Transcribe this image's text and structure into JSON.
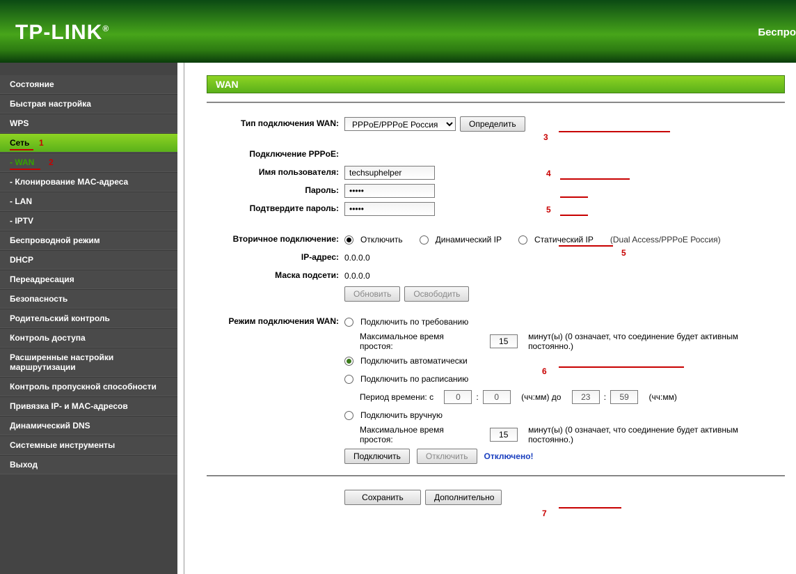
{
  "header": {
    "logo": "TP-LINK",
    "reg": "®",
    "right": "Беспро"
  },
  "sidebar": [
    {
      "label": "Состояние",
      "cls": ""
    },
    {
      "label": "Быстрая настройка",
      "cls": ""
    },
    {
      "label": "WPS",
      "cls": ""
    },
    {
      "label": "Сеть",
      "cls": "lvl1-active",
      "marker": "1"
    },
    {
      "label": "- WAN",
      "cls": "sub lvl2-active",
      "marker": "2"
    },
    {
      "label": "- Клонирование MAC-адреса",
      "cls": "sub"
    },
    {
      "label": "- LAN",
      "cls": "sub"
    },
    {
      "label": "- IPTV",
      "cls": "sub"
    },
    {
      "label": "Беспроводной режим",
      "cls": ""
    },
    {
      "label": "DHCP",
      "cls": ""
    },
    {
      "label": "Переадресация",
      "cls": ""
    },
    {
      "label": "Безопасность",
      "cls": ""
    },
    {
      "label": "Родительский контроль",
      "cls": ""
    },
    {
      "label": "Контроль доступа",
      "cls": ""
    },
    {
      "label": "Расширенные настройки маршрутизации",
      "cls": ""
    },
    {
      "label": "Контроль пропускной способности",
      "cls": ""
    },
    {
      "label": "Привязка IP- и MAC-адресов",
      "cls": ""
    },
    {
      "label": "Динамический DNS",
      "cls": ""
    },
    {
      "label": "Системные инструменты",
      "cls": ""
    },
    {
      "label": "Выход",
      "cls": ""
    }
  ],
  "title": "WAN",
  "wan_type": {
    "label": "Тип подключения WAN:",
    "value": "PPPoE/PPPoE Россия",
    "detect": "Определить",
    "marker": "3"
  },
  "pppoe": {
    "section": "Подключение PPPoE:",
    "user_lbl": "Имя пользователя:",
    "user_val": "techsuphelper",
    "user_marker": "4",
    "pass_lbl": "Пароль:",
    "pass_val": "•••••",
    "pass2_lbl": "Подтвердите пароль:",
    "pass2_val": "•••••",
    "pass2_marker": "5"
  },
  "secondary": {
    "label": "Вторичное подключение:",
    "opt1": "Отключить",
    "opt2": "Динамический IP",
    "opt3": "Статический IP",
    "hint": "(Dual Access/PPPoE Россия)",
    "marker": "5",
    "ip_lbl": "IP-адрес:",
    "ip_val": "0.0.0.0",
    "mask_lbl": "Маска подсети:",
    "mask_val": "0.0.0.0",
    "btn1": "Обновить",
    "btn2": "Освободить"
  },
  "mode": {
    "label": "Режим подключения WAN:",
    "opt1": "Подключить по требованию",
    "idle_lbl": "Максимальное время простоя:",
    "idle_val": "15",
    "idle_hint": "минут(ы) (0 означает, что соединение будет активным постоянно.)",
    "opt2": "Подключить автоматически",
    "marker": "6",
    "opt3": "Подключить по расписанию",
    "sched_lbl": "Период времени:  с",
    "h1": "0",
    "m1": "0",
    "to": "(чч:мм) до",
    "h2": "23",
    "m2": "59",
    "sched_hint": "(чч:мм)",
    "opt4": "Подключить вручную",
    "connect": "Подключить",
    "disconnect": "Отключить",
    "status": "Отключено!"
  },
  "footer": {
    "save": "Сохранить",
    "adv": "Дополнительно",
    "marker": "7"
  }
}
